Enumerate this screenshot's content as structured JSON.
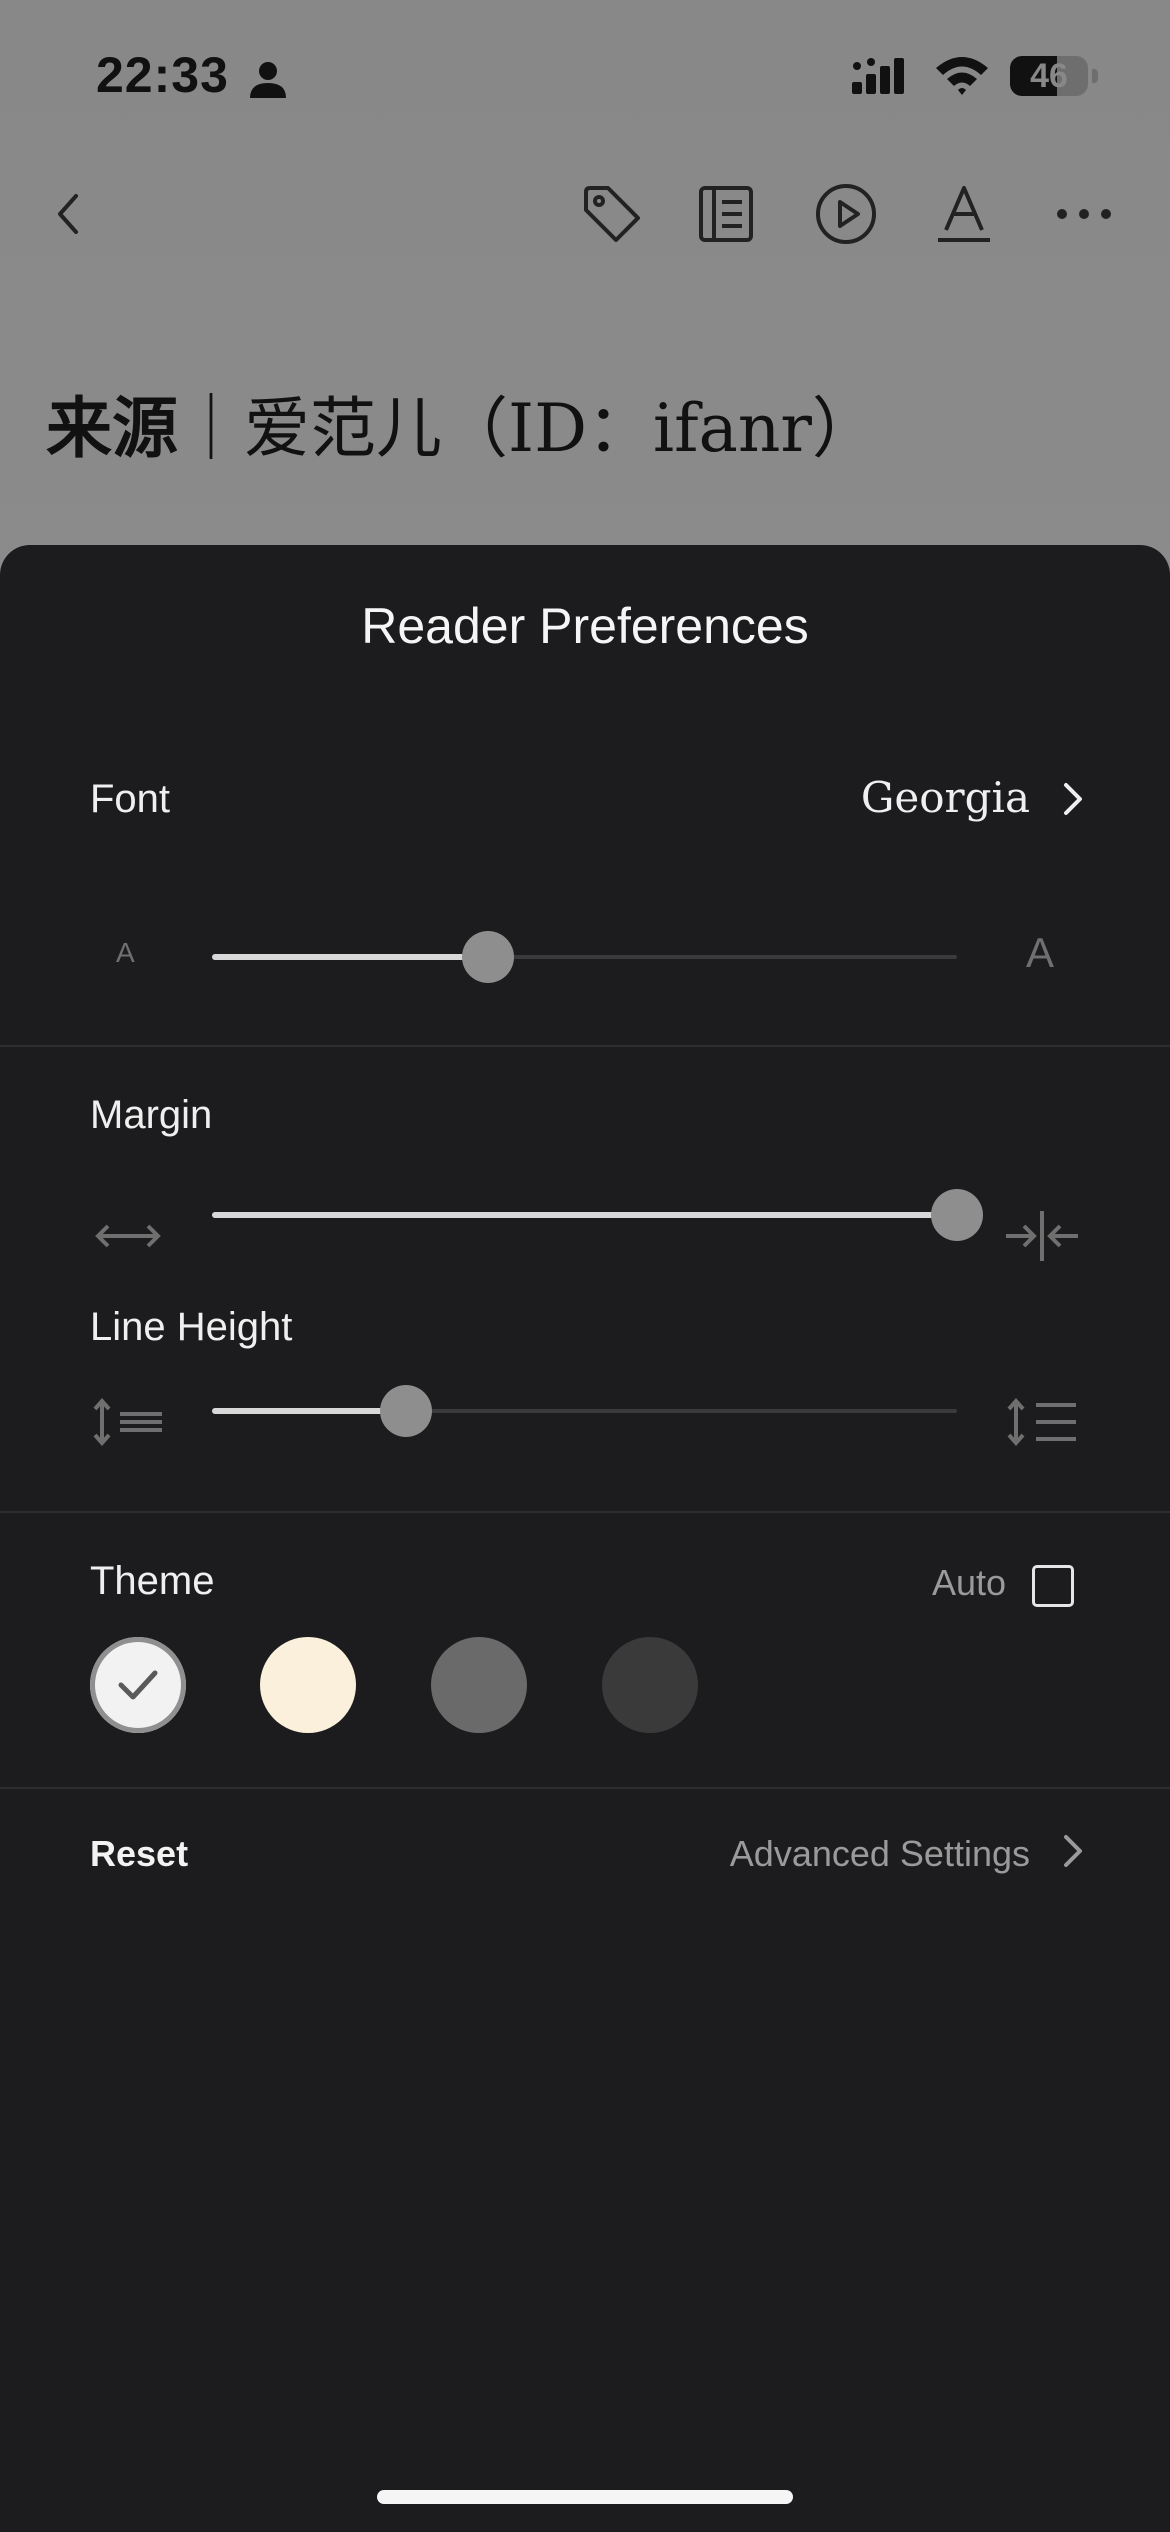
{
  "status_bar": {
    "time": "22:33",
    "battery": "46",
    "person_icon": "person-icon",
    "signal_icon": "cellular-signal-icon",
    "wifi_icon": "wifi-icon"
  },
  "toolbar": {
    "back_icon": "chevron-left-icon",
    "icons": [
      "tag-icon",
      "notebook-icon",
      "play-circle-icon",
      "text-format-icon",
      "more-horizontal-icon"
    ]
  },
  "article": {
    "title_bold": "来源",
    "title_rest": "｜爱范儿（ID：ifanr）"
  },
  "sheet": {
    "title": "Reader Preferences",
    "font": {
      "label": "Font",
      "value": "Georgia",
      "small_glyph": "A",
      "large_glyph": "A",
      "size_level": 0.37
    },
    "margin": {
      "label": "Margin",
      "level": 1.0,
      "left_icon": "arrows-horizontal-icon",
      "right_icon": "arrows-compress-icon"
    },
    "line_height": {
      "label": "Line Height",
      "level": 0.26,
      "left_icon": "line-height-small-icon",
      "right_icon": "line-height-large-icon"
    },
    "theme": {
      "label": "Theme",
      "auto_label": "Auto",
      "auto_checked": false,
      "swatches": [
        {
          "name": "white",
          "color": "#f2f2f2",
          "selected": true
        },
        {
          "name": "sepia",
          "color": "#faf0dc",
          "selected": false
        },
        {
          "name": "gray",
          "color": "#6a6a6a",
          "selected": false
        },
        {
          "name": "dark",
          "color": "#3a3a3a",
          "selected": false
        }
      ]
    },
    "reset_label": "Reset",
    "advanced_label": "Advanced Settings"
  }
}
